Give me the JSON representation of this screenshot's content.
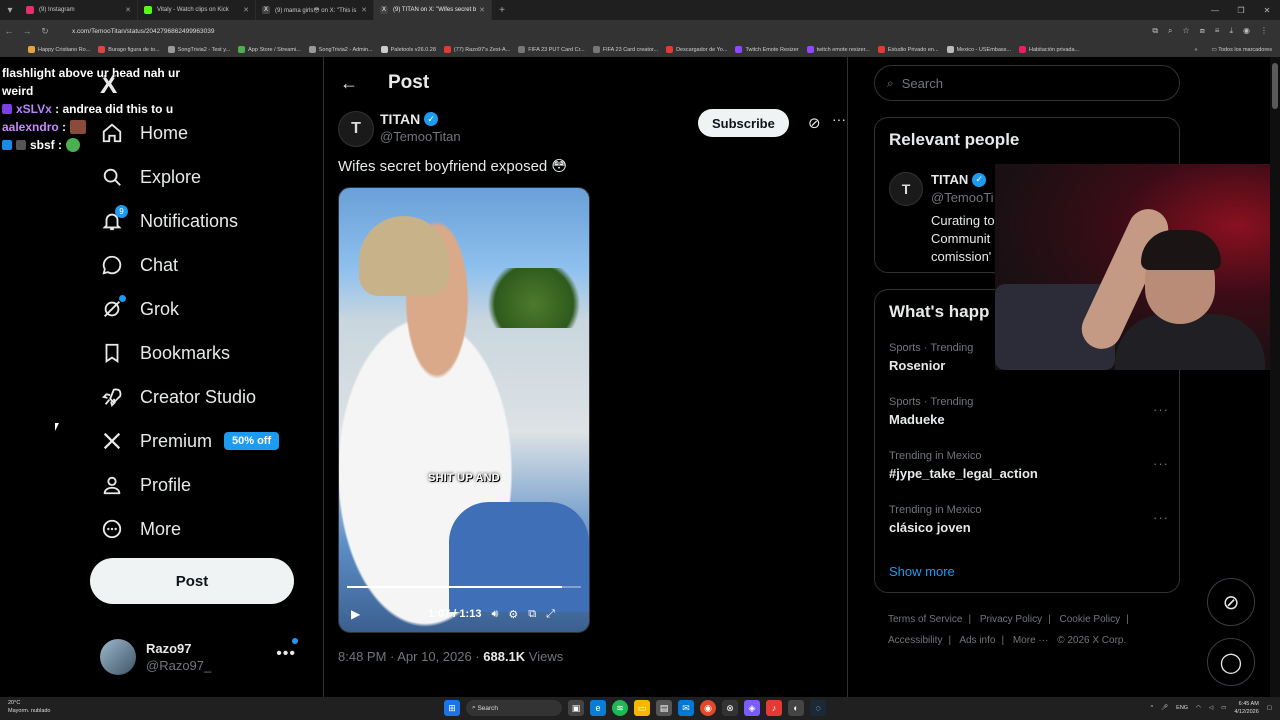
{
  "browser": {
    "tabs": [
      {
        "title": "(9) Instagram",
        "color": "#e1306c",
        "active": false
      },
      {
        "title": "Vitaly - Watch clips on Kick",
        "color": "#53fc18",
        "active": false
      },
      {
        "title": "(9) mama girls😳 on X: \"This is",
        "color": "#ffffff",
        "active": false
      },
      {
        "title": "(9) TITAN on X: \"Wifes secret b",
        "color": "#ffffff",
        "active": true
      }
    ],
    "new_tab": "+",
    "url": "x.com/TemooTitan/status/2042796862499963039",
    "bookmarks": [
      "Happy Cristiano Ro...",
      "Burago figura de to...",
      "SongTrivia2 - Test y...",
      "App Store / Streami...",
      "SongTrivia2 - Admin...",
      "Paletools v26.0.28",
      "(77) Razo97's Zest-A...",
      "FIFA 23 PUT Card Cr...",
      "FIFA 23 Card creator...",
      "Descargador de Yo...",
      "Twitch Emote Resizer",
      "twitch emote resizer...",
      "Estudio Privado en...",
      "Mexico - USEmbass...",
      "Habitación privada..."
    ],
    "bookmarks_more": "»",
    "bookmarks_folder": "Todos los marcadores"
  },
  "nav": {
    "logo": "X",
    "items": [
      {
        "label": "Home",
        "icon": "home-icon"
      },
      {
        "label": "Explore",
        "icon": "search-icon"
      },
      {
        "label": "Notifications",
        "icon": "bell-icon",
        "badge": "9"
      },
      {
        "label": "Chat",
        "icon": "chat-icon"
      },
      {
        "label": "Grok",
        "icon": "grok-icon"
      },
      {
        "label": "Bookmarks",
        "icon": "bookmark-icon"
      },
      {
        "label": "Creator Studio",
        "icon": "rocket-icon"
      },
      {
        "label": "Premium",
        "icon": "x-icon",
        "tag": "50% off"
      },
      {
        "label": "Profile",
        "icon": "person-icon"
      },
      {
        "label": "More",
        "icon": "more-circle-icon"
      }
    ],
    "post_button": "Post",
    "account": {
      "name": "Razo97",
      "handle": "@Razo97_",
      "more": "•••"
    }
  },
  "post": {
    "header": "Post",
    "author": {
      "name": "TITAN",
      "handle": "@TemooTitan",
      "avatar_letter": "T"
    },
    "subscribe": "Subscribe",
    "text": "Wifes secret boyfriend exposed 😳",
    "video": {
      "caption": "SHIT UP AND",
      "time": "1:07 / 1:13",
      "progress": 0.92
    },
    "timestamp": "8:48 PM · Apr 10, 2026 · ",
    "views_count": "688.1K",
    "views_label": " Views"
  },
  "sidebar": {
    "search_placeholder": "Search",
    "relevant_title": "Relevant people",
    "relevant": {
      "name": "TITAN",
      "handle": "@TemooTi",
      "bio": "Curating to\nCommunit\ncomission'",
      "avatar_letter": "T"
    },
    "happening_title": "What's happ",
    "trends": [
      {
        "context": "Sports · Trending",
        "title": "Rosenior"
      },
      {
        "context": "Sports · Trending",
        "title": "Madueke"
      },
      {
        "context": "Trending in Mexico",
        "title": "#jype_take_legal_action"
      },
      {
        "context": "Trending in Mexico",
        "title": "clásico joven"
      }
    ],
    "show_more": "Show more",
    "footer": [
      "Terms of Service",
      "|",
      "Privacy Policy",
      "|",
      "Cookie Policy",
      "|",
      "Accessibility",
      "|",
      "Ads info",
      "|",
      "More ···",
      "© 2026 X Corp."
    ]
  },
  "chat_overlay": [
    {
      "user": "",
      "text": "flashlight above ur head nah ur weird"
    },
    {
      "user": "xSLVx",
      "text": ": andrea did this to u"
    },
    {
      "user": "aalexndro",
      "text": ":"
    },
    {
      "user": "sbsf",
      "text": ":"
    }
  ],
  "taskbar": {
    "weather_temp": "20°C",
    "weather_desc": "Mayorm. nublado",
    "search": "Search",
    "lang": "ENG",
    "time": "6:45 AM",
    "date": "4/12/2026"
  }
}
